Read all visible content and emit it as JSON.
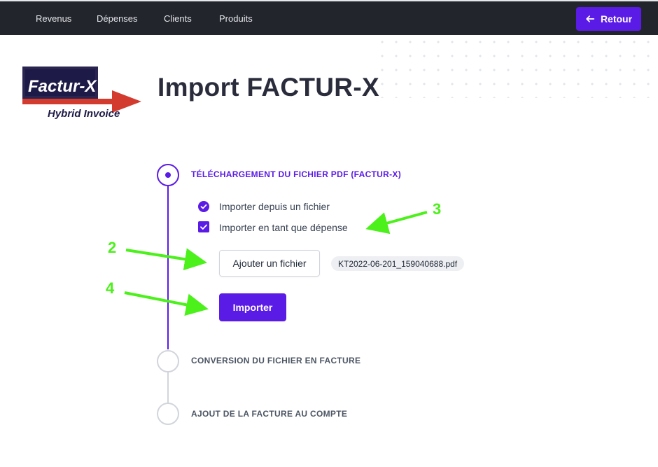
{
  "nav": {
    "items": [
      {
        "label": "Revenus"
      },
      {
        "label": "Dépenses"
      },
      {
        "label": "Clients"
      },
      {
        "label": "Produits"
      }
    ],
    "back_label": "Retour"
  },
  "logo": {
    "line1": "Factur-X",
    "line2": "Hybrid Invoice"
  },
  "page": {
    "title": "Import FACTUR-X"
  },
  "steps": [
    {
      "label": "TÉLÉCHARGEMENT DU FICHIER PDF (FACTUR-X)",
      "state": "current"
    },
    {
      "label": "CONVERSION DU FICHIER EN FACTURE",
      "state": "pending"
    },
    {
      "label": "AJOUT DE LA FACTURE AU COMPTE",
      "state": "pending"
    }
  ],
  "options": {
    "from_file": {
      "label": "Importer depuis un fichier",
      "selected": true
    },
    "as_expense": {
      "label": "Importer en tant que dépense",
      "checked": true
    }
  },
  "upload": {
    "add_label": "Ajouter un fichier",
    "filename": "KT2022-06-201_159040688.pdf"
  },
  "import_label": "Importer",
  "annotations": {
    "n2": "2",
    "n3": "3",
    "n4": "4",
    "color": "#4cf01b"
  },
  "colors": {
    "accent": "#5b1be6",
    "navbar": "#23252d"
  }
}
